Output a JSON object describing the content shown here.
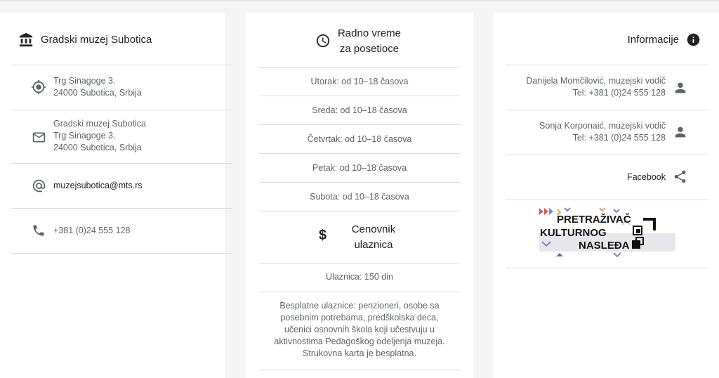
{
  "left": {
    "title": "Gradski muzej Subotica",
    "address": [
      "Trg Sinagoge 3.",
      "24000 Subotica, Srbija"
    ],
    "mail": [
      "Gradski muzej Subotica",
      "Trg Sinagoge 3.",
      "24000 Subotica, Srbija"
    ],
    "email": "muzejsubotica@mts.rs",
    "phone": "+381 (0)24 555 128"
  },
  "middle": {
    "hours_title": [
      "Radno vreme",
      "za posetioce"
    ],
    "hours": [
      "Utorak: od 10–18 časova",
      "Sreda: od 10–18 časova",
      "Četvrtak: od 10–18 časova",
      "Petak: od 10–18 časova",
      "Subota: od 10–18 časova"
    ],
    "price_title": [
      "Cenovnik",
      "ulaznica"
    ],
    "ticket": "Ulaznica: 150 din",
    "free": [
      "Besplatne ulaznice: penzioneri, osobe sa",
      "posebnim potrebama, predškolska deca,",
      "učenici osnovnih škola koji učestvuju u",
      "aktivnostima Pedagoškog odeljenja muzeja.",
      "Strukovna karta je besplatna."
    ]
  },
  "right": {
    "title": "Informacije",
    "guides": [
      {
        "name": "Danijela Momčilović, muzejski vodič",
        "tel": "Tel: +381 (0)24 555 128"
      },
      {
        "name": "Sonja Korponaić, muzejski vodič",
        "tel": "Tel: +381 (0)24 555 128"
      }
    ],
    "facebook": "Facebook",
    "banner": [
      "PRETRAŽIVAČ",
      "KULTURNOG",
      "NASLEĐA"
    ]
  },
  "icons": {
    "museum": "museum-icon",
    "location": "location-target-icon",
    "mail": "mail-icon",
    "at": "at-sign-icon",
    "phone": "phone-icon",
    "clock": "clock-icon",
    "dollar": "dollar-icon",
    "info": "info-icon",
    "person": "person-icon",
    "share": "share-icon"
  }
}
